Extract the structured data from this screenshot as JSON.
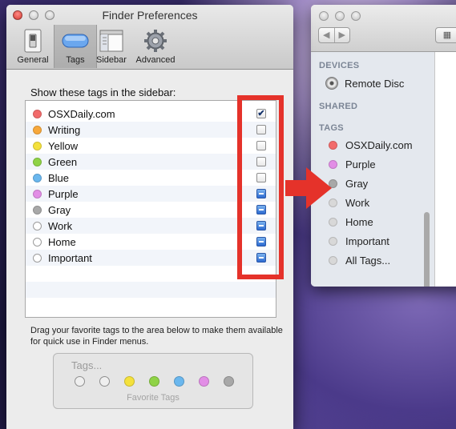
{
  "prefs": {
    "title": "Finder Preferences",
    "toolbar": [
      {
        "label": "General",
        "icon": "light-switch-icon",
        "selected": false
      },
      {
        "label": "Tags",
        "icon": "tag-icon",
        "selected": true
      },
      {
        "label": "Sidebar",
        "icon": "sidebar-icon",
        "selected": false
      },
      {
        "label": "Advanced",
        "icon": "gear-icon",
        "selected": false
      }
    ],
    "section_label": "Show these tags in the sidebar:",
    "tags": [
      {
        "name": "OSXDaily.com",
        "color": "#f26b6b",
        "state": "checked"
      },
      {
        "name": "Writing",
        "color": "#f7a83c",
        "state": "unchecked"
      },
      {
        "name": "Yellow",
        "color": "#f4e13c",
        "state": "unchecked"
      },
      {
        "name": "Green",
        "color": "#8fd346",
        "state": "unchecked"
      },
      {
        "name": "Blue",
        "color": "#6ab7ee",
        "state": "unchecked"
      },
      {
        "name": "Purple",
        "color": "#e28ee6",
        "state": "mixed"
      },
      {
        "name": "Gray",
        "color": "#a8a8a8",
        "state": "mixed"
      },
      {
        "name": "Work",
        "color": "none",
        "state": "mixed"
      },
      {
        "name": "Home",
        "color": "none",
        "state": "mixed"
      },
      {
        "name": "Important",
        "color": "none",
        "state": "mixed"
      }
    ],
    "drag_text": "Drag your favorite tags to the area below to make them available for quick use in Finder menus.",
    "favorites": {
      "placeholder": "Tags...",
      "caption": "Favorite Tags",
      "dots": [
        "none",
        "none",
        "#f4e13c",
        "#8fd346",
        "#6ab7ee",
        "#e28ee6",
        "#a8a8a8"
      ]
    }
  },
  "finder": {
    "nav_back": "◀",
    "nav_forward": "▶",
    "view_button": "▦",
    "devices_heading": "DEVICES",
    "devices": [
      {
        "name": "Remote Disc",
        "icon": "disc-icon"
      }
    ],
    "shared_heading": "SHARED",
    "tags_heading": "TAGS",
    "tags": [
      {
        "name": "OSXDaily.com",
        "color": "#f26b6b"
      },
      {
        "name": "Purple",
        "color": "#e28ee6"
      },
      {
        "name": "Gray",
        "color": "#a8a8a8"
      },
      {
        "name": "Work",
        "color": "#d8d8d8"
      },
      {
        "name": "Home",
        "color": "#d8d8d8"
      },
      {
        "name": "Important",
        "color": "#d8d8d8"
      },
      {
        "name": "All Tags...",
        "color": "#d8d8d8"
      }
    ]
  },
  "annotation": {
    "highlight_color": "#e5322a"
  }
}
